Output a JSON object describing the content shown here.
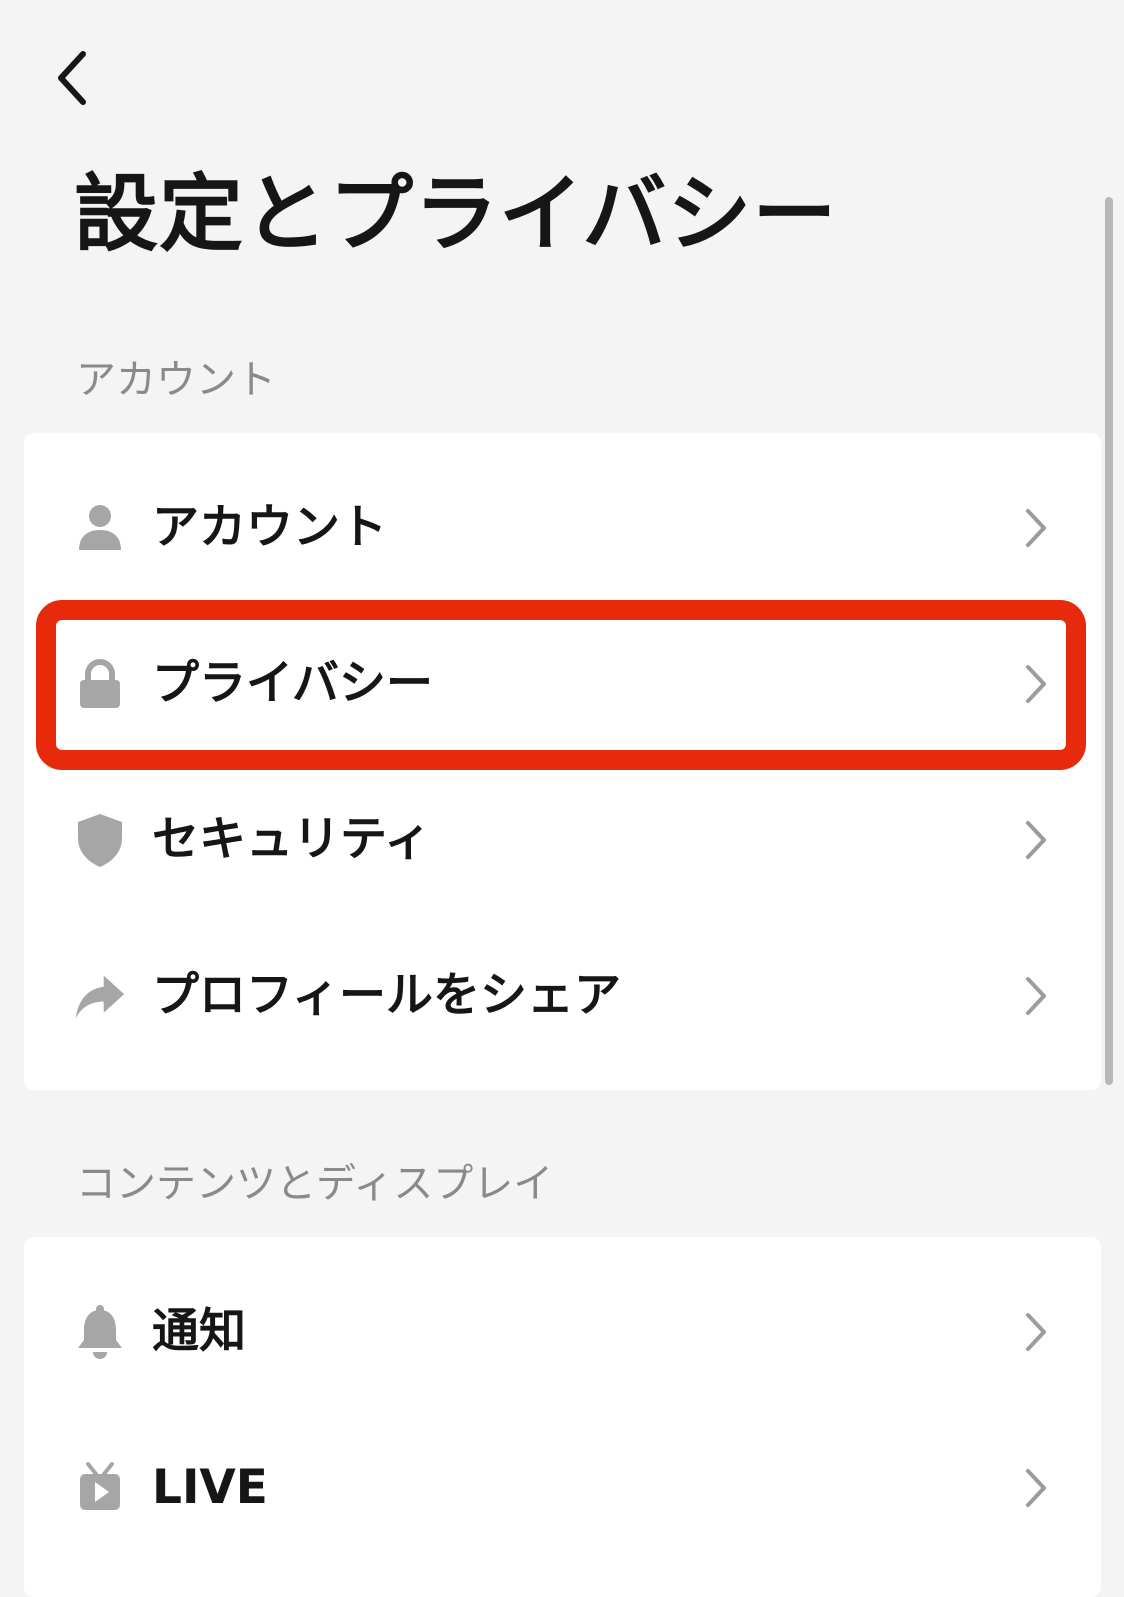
{
  "header": {
    "back_icon": "chevron-left-icon",
    "title": "設定とプライバシー"
  },
  "sections": [
    {
      "label": "アカウント",
      "items": [
        {
          "label": "アカウント",
          "icon": "person-icon"
        },
        {
          "label": "プライバシー",
          "icon": "lock-icon",
          "highlighted": true
        },
        {
          "label": "セキュリティ",
          "icon": "shield-icon"
        },
        {
          "label": "プロフィールをシェア",
          "icon": "share-icon"
        }
      ]
    },
    {
      "label": "コンテンツとディスプレイ",
      "items": [
        {
          "label": "通知",
          "icon": "bell-icon"
        },
        {
          "label": "LIVE",
          "icon": "live-tv-icon"
        }
      ]
    }
  ],
  "colors": {
    "background": "#f4f4f4",
    "card": "#ffffff",
    "icon_gray": "#a6a6a6",
    "chevron_gray": "#9c9c9c",
    "section_label": "#8a8a8a",
    "highlight_red": "#e82a0c",
    "text": "#161616"
  }
}
